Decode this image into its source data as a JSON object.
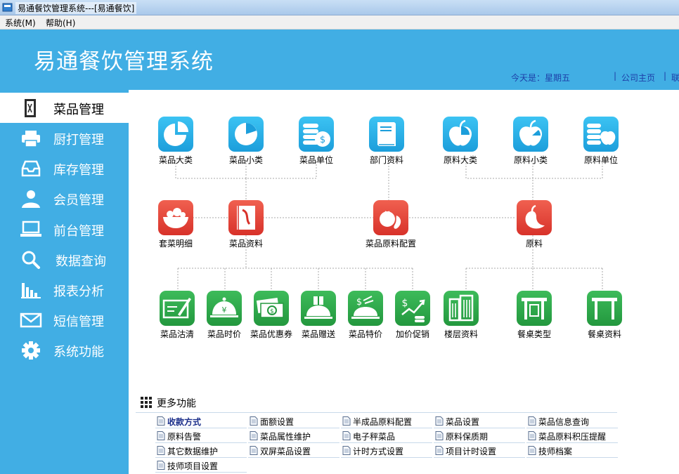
{
  "window": {
    "title": "易通餐饮管理系统---[易通餐饮]"
  },
  "menubar": {
    "items": [
      {
        "label": "系统(M)"
      },
      {
        "label": "帮助(H)"
      }
    ]
  },
  "header": {
    "app_title": "易通餐饮管理系统",
    "date_label": "今天是：星期五",
    "links": [
      {
        "label": "公司主页"
      },
      {
        "label": "联"
      }
    ]
  },
  "sidebar": {
    "items": [
      {
        "label": "菜品管理",
        "icon": "door-icon",
        "active": true
      },
      {
        "label": "厨打管理",
        "icon": "printer-icon"
      },
      {
        "label": "库存管理",
        "icon": "inbox-icon"
      },
      {
        "label": "会员管理",
        "icon": "user-icon"
      },
      {
        "label": "前台管理",
        "icon": "laptop-icon"
      },
      {
        "label": "数据查询",
        "icon": "search-icon"
      },
      {
        "label": "报表分析",
        "icon": "bar-chart-icon"
      },
      {
        "label": "短信管理",
        "icon": "envelope-icon"
      },
      {
        "label": "系统功能",
        "icon": "gear-icon"
      }
    ]
  },
  "tiles": {
    "row1": [
      {
        "label": "菜品大类",
        "icon": "pie-chart-icon"
      },
      {
        "label": "菜品小类",
        "icon": "pie-chart-small-icon"
      },
      {
        "label": "菜品单位",
        "icon": "coins-icon"
      },
      {
        "label": "部门资料",
        "icon": "book-icon"
      },
      {
        "label": "原料大类",
        "icon": "apple-pie-icon"
      },
      {
        "label": "原料小类",
        "icon": "apple-pie-small-icon"
      },
      {
        "label": "原料单位",
        "icon": "coins-apple-icon"
      }
    ],
    "row2": [
      {
        "label": "套菜明细",
        "icon": "salad-bowl-icon"
      },
      {
        "label": "菜品资料",
        "icon": "menu-book-icon"
      },
      {
        "label": "菜品原料配置",
        "icon": "tomato-pepper-icon"
      },
      {
        "label": "原料",
        "icon": "pepper-icon"
      }
    ],
    "row3": [
      {
        "label": "菜品沽清",
        "icon": "check-write-icon"
      },
      {
        "label": "菜品时价",
        "icon": "cloche-yen-icon"
      },
      {
        "label": "菜品优惠券",
        "icon": "cash-icon"
      },
      {
        "label": "菜品赠送",
        "icon": "gift-cloche-icon"
      },
      {
        "label": "菜品特价",
        "icon": "special-price-icon"
      },
      {
        "label": "加价促销",
        "icon": "price-up-icon"
      },
      {
        "label": "楼层资料",
        "icon": "building-icon"
      },
      {
        "label": "餐桌类型",
        "icon": "table-type-icon"
      },
      {
        "label": "餐桌资料",
        "icon": "table-icon"
      }
    ]
  },
  "more": {
    "title": "更多功能",
    "items": [
      {
        "label": "收款方式",
        "bold": true
      },
      {
        "label": "面额设置"
      },
      {
        "label": "半成品原料配置"
      },
      {
        "label": "菜品设置"
      },
      {
        "label": "菜品信息查询"
      },
      {
        "label": "原料告警"
      },
      {
        "label": "菜品属性维护"
      },
      {
        "label": "电子秤菜品"
      },
      {
        "label": "原料保质期"
      },
      {
        "label": "菜品原料积压提醒"
      },
      {
        "label": "其它数据维护"
      },
      {
        "label": "双屏菜品设置"
      },
      {
        "label": "计时方式设置"
      },
      {
        "label": "项目计时设置"
      },
      {
        "label": "技师档案"
      },
      {
        "label": "技师项目设置"
      }
    ]
  },
  "colors": {
    "accent": "#41aee4",
    "tile_blue": "#29b2ea",
    "tile_red": "#e2443a",
    "tile_green": "#2ea94a",
    "link": "#1d3fa8"
  }
}
